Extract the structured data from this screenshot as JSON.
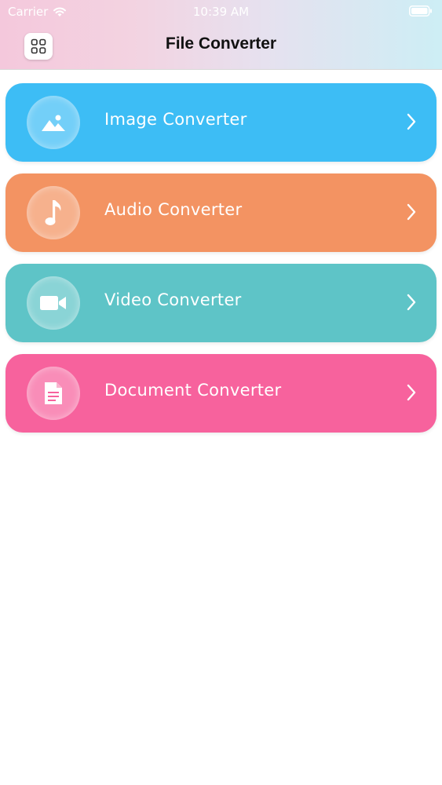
{
  "status_bar": {
    "carrier": "Carrier",
    "time": "10:39 AM"
  },
  "header": {
    "title": "File Converter",
    "menu_icon": "grid-icon"
  },
  "converters": [
    {
      "label": "Image Converter",
      "icon": "image-icon",
      "color": "#3dbdf5"
    },
    {
      "label": "Audio Converter",
      "icon": "music-note-icon",
      "color": "#f39362"
    },
    {
      "label": "Video Converter",
      "icon": "video-camera-icon",
      "color": "#5ec4c7"
    },
    {
      "label": "Document Converter",
      "icon": "document-icon",
      "color": "#f7629d"
    }
  ]
}
